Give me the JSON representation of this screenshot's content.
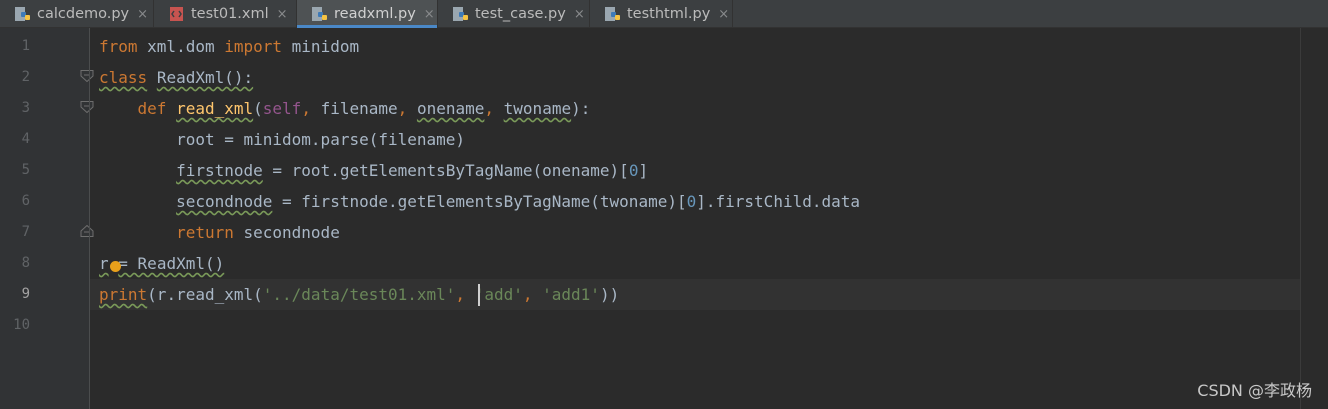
{
  "tabs": [
    {
      "label": "calcdemo.py",
      "icon": "python-file-icon",
      "active": false
    },
    {
      "label": "test01.xml",
      "icon": "xml-file-icon",
      "active": false
    },
    {
      "label": "readxml.py",
      "icon": "python-file-icon",
      "active": true
    },
    {
      "label": "test_case.py",
      "icon": "python-file-icon",
      "active": false
    },
    {
      "label": "testhtml.py",
      "icon": "python-file-icon",
      "active": false
    }
  ],
  "close_glyph": "×",
  "line_numbers": [
    "1",
    "2",
    "3",
    "4",
    "5",
    "6",
    "7",
    "8",
    "9",
    "10"
  ],
  "current_line": "9",
  "code": {
    "l1": {
      "kw_from": "from",
      "module": " xml.dom ",
      "kw_import": "import",
      "name": " minidom"
    },
    "l2": {
      "kw_class": "class",
      "space": " ",
      "classname": "ReadXml():"
    },
    "l3": {
      "indent": "    ",
      "kw_def": "def",
      "space": " ",
      "fname": "read_xml",
      "open": "(",
      "self": "self",
      "comma1": ",",
      "p1": " filename",
      "comma2": ",",
      "sp2": " ",
      "p2": "onename",
      "comma3": ",",
      "sp3": " ",
      "p3": "twoname",
      "close": "):"
    },
    "l4": {
      "indent": "        ",
      "text": "root = minidom.parse(filename)"
    },
    "l5": {
      "indent": "        ",
      "var": "firstnode",
      "text": " = root.getElementsByTagName(onename)[",
      "num": "0",
      "end": "]"
    },
    "l6": {
      "indent": "        ",
      "var": "secondnode",
      "text": " = firstnode.getElementsByTagName(twoname)[",
      "num": "0",
      "end": "].firstChild.data"
    },
    "l7": {
      "indent": "        ",
      "kw_return": "return",
      "text": " secondnode"
    },
    "l8": {
      "var": "r",
      "pad": " ",
      "text": "= ReadXml()"
    },
    "l9": {
      "fn": "print",
      "t1": "(r.read_xml(",
      "s1": "'../data/test01.xml'",
      "c1": ",",
      "sp": " ",
      "s2": "'add'",
      "c2": ", ",
      "s3": "'add1'",
      "end": "))"
    }
  },
  "watermark": "CSDN @李政杨",
  "colors": {
    "background": "#2b2b2b",
    "keyword": "#cc7832",
    "string": "#6a8759",
    "number": "#6897bb",
    "function": "#ffc66d",
    "self": "#94558d",
    "text": "#a9b7c6",
    "active_tab_underline": "#4a88c7"
  }
}
